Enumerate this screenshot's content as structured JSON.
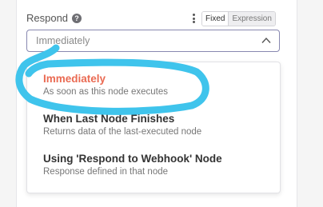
{
  "field": {
    "label": "Respond",
    "help_icon": "question-circle-icon",
    "menu_icon": "kebab-icon",
    "mode": {
      "fixed": "Fixed",
      "expression": "Expression",
      "selected": "Fixed"
    },
    "value": "Immediately",
    "chevron_icon": "chevron-up-icon"
  },
  "dropdown": {
    "options": [
      {
        "title": "Immediately",
        "description": "As soon as this node executes",
        "selected": true
      },
      {
        "title": "When Last Node Finishes",
        "description": "Returns data of the last-executed node",
        "selected": false
      },
      {
        "title": "Using 'Respond to Webhook' Node",
        "description": "Response defined in that node",
        "selected": false
      }
    ]
  },
  "colors": {
    "accent_selected": "#ea6a52",
    "annotation_stroke": "#3fc4ec"
  }
}
